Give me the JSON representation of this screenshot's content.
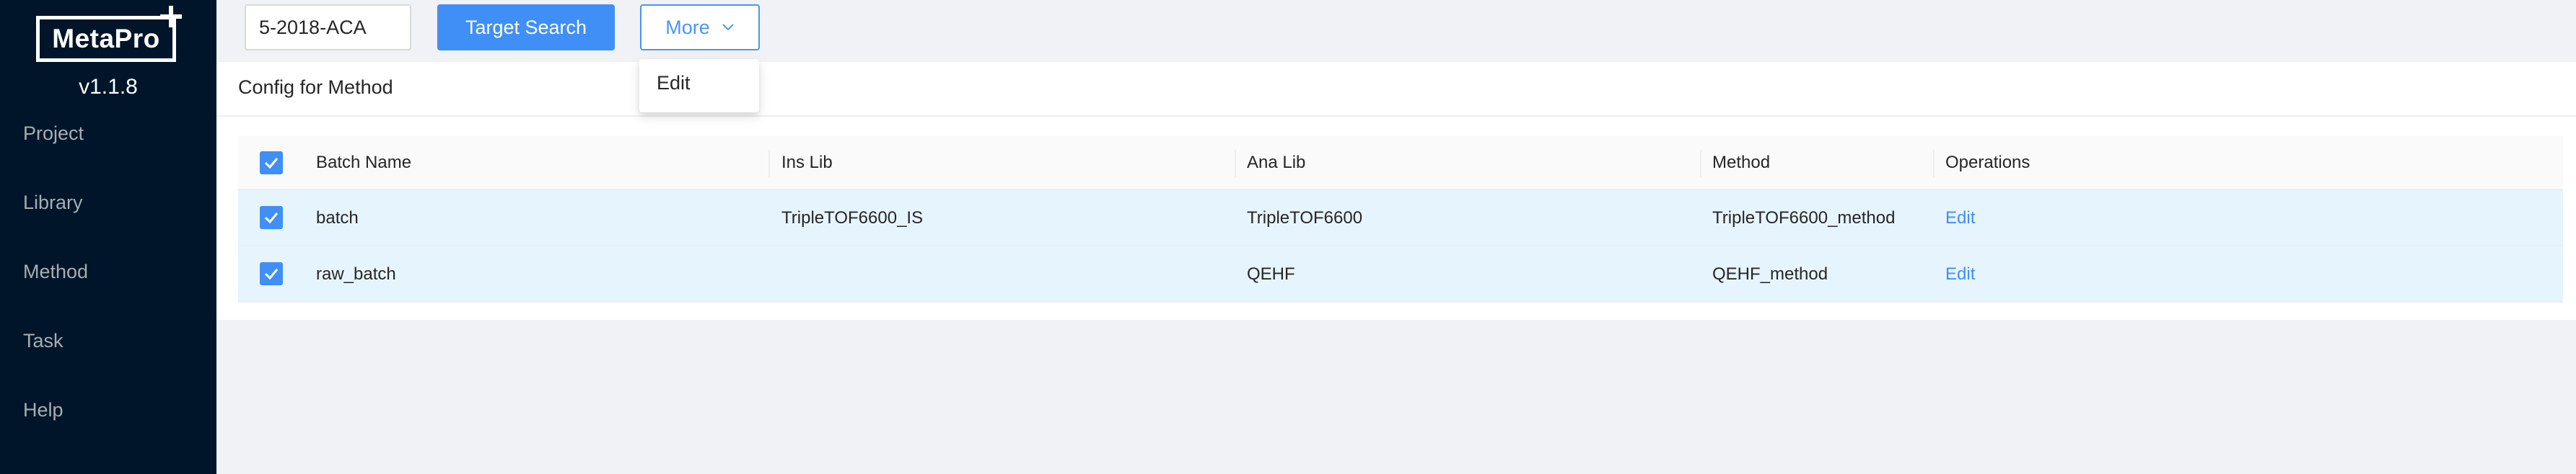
{
  "sidebar": {
    "logo_text": "MetaPro",
    "version": "v1.1.8",
    "items": [
      {
        "label": "Project"
      },
      {
        "label": "Library"
      },
      {
        "label": "Method"
      },
      {
        "label": "Task"
      },
      {
        "label": "Help"
      }
    ]
  },
  "header": {
    "search_value": "5-2018-ACA",
    "target_search_label": "Target Search",
    "more_label": "More",
    "more_menu": [
      {
        "label": "Edit"
      }
    ]
  },
  "card": {
    "title": "Config for Method"
  },
  "table": {
    "columns": [
      "Batch Name",
      "Ins Lib",
      "Ana Lib",
      "Method",
      "Operations"
    ],
    "rows": [
      {
        "batch_name": "batch",
        "ins_lib": "TripleTOF6600_IS",
        "ana_lib": "TripleTOF6600",
        "method": "TripleTOF6600_method",
        "operation": "Edit",
        "checked": true
      },
      {
        "batch_name": "raw_batch",
        "ins_lib": "",
        "ana_lib": "QEHF",
        "method": "QEHF_method",
        "operation": "Edit",
        "checked": true
      }
    ],
    "header_checked": true
  },
  "colors": {
    "sidebar_bg": "#001529",
    "primary": "#3f8ff7",
    "selected_row_bg": "#e6f4fd",
    "page_bg": "#f0f2f5"
  }
}
